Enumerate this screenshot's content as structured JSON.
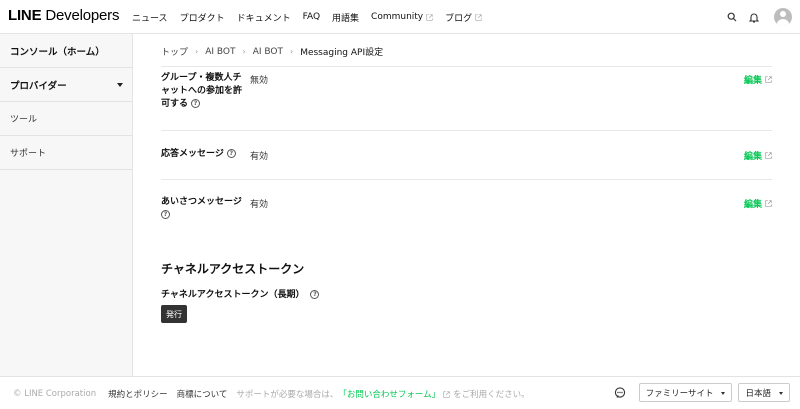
{
  "header": {
    "logo_line": "LINE",
    "logo_dev": "Developers",
    "nav": [
      {
        "label": "ニュース",
        "external": false
      },
      {
        "label": "プロダクト",
        "external": false
      },
      {
        "label": "ドキュメント",
        "external": false
      },
      {
        "label": "FAQ",
        "external": false
      },
      {
        "label": "用語集",
        "external": false
      },
      {
        "label": "Community",
        "external": true
      },
      {
        "label": "ブログ",
        "external": true
      }
    ],
    "icons": [
      "search-icon",
      "bell-icon",
      "avatar"
    ]
  },
  "sidebar": {
    "items": [
      {
        "label": "コンソール（ホーム）",
        "bold": true
      },
      {
        "label": "プロバイダー",
        "bold": true,
        "dropdown": true
      },
      {
        "label": "ツール",
        "bold": false
      },
      {
        "label": "サポート",
        "bold": false
      }
    ]
  },
  "breadcrumb": [
    "トップ",
    "AI BOT",
    "AI BOT",
    "Messaging API設定"
  ],
  "settings": [
    {
      "label_lines": [
        "グループ・複数人チ",
        "ャットへの参加を許",
        "可する"
      ],
      "value": "無効",
      "edit": "編集"
    },
    {
      "label_lines": [
        "応答メッセージ"
      ],
      "value": "有効",
      "edit": "編集"
    },
    {
      "label_lines": [
        "あいさつメッセージ"
      ],
      "value": "有効",
      "edit": "編集"
    }
  ],
  "token_section": {
    "title": "チャネルアクセストークン",
    "subtitle": "チャネルアクセストークン（長期）",
    "button": "発行"
  },
  "footer": {
    "copyright": "© LINE Corporation",
    "links": [
      "規約とポリシー",
      "商標について"
    ],
    "support_text_prefix": "サポートが必要な場合は、",
    "support_link": "「お問い合わせフォーム」",
    "support_text_suffix": "をご利用ください。",
    "family_site": "ファミリーサイト",
    "language": "日本語"
  },
  "colors": {
    "accent_green": "#06c755",
    "sidebar_bg": "#f7f7f7",
    "button_dark": "#333333"
  }
}
